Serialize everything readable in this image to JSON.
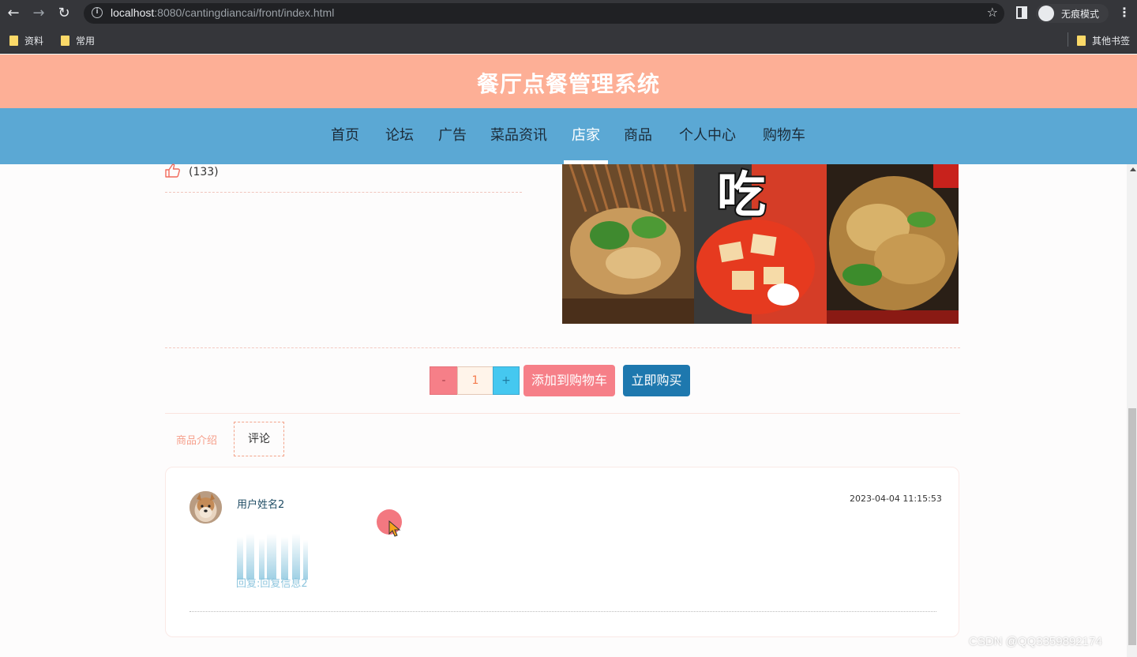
{
  "browser": {
    "url_host": "localhost",
    "url_path": ":8080/cantingdiancai/front/index.html",
    "incognito_label": "无痕模式",
    "bookmarks": [
      "资料",
      "常用"
    ],
    "other_bookmarks": "其他书签"
  },
  "site": {
    "title": "餐厅点餐管理系统",
    "nav": [
      "首页",
      "论坛",
      "广告",
      "菜品资讯",
      "店家",
      "商品",
      "个人中心",
      "购物车"
    ],
    "active_nav": "店家"
  },
  "product": {
    "like_count": "(133)",
    "image_text": "吃"
  },
  "purchase": {
    "minus": "-",
    "quantity": "1",
    "plus": "+",
    "add_to_cart": "添加到购物车",
    "buy_now": "立即购买"
  },
  "tabs": {
    "intro": "商品介绍",
    "review": "评论"
  },
  "review": {
    "username": "用户姓名2",
    "time": "2023-04-04 11:15:53",
    "reply": "回复:回复信息2"
  },
  "colors": {
    "header_bg": "#fdaf96",
    "nav_bg": "#5ba8d4",
    "cart_btn": "#f67f88",
    "buy_btn": "#1e78ae"
  },
  "watermark": "CSDN @QQ3359892174"
}
